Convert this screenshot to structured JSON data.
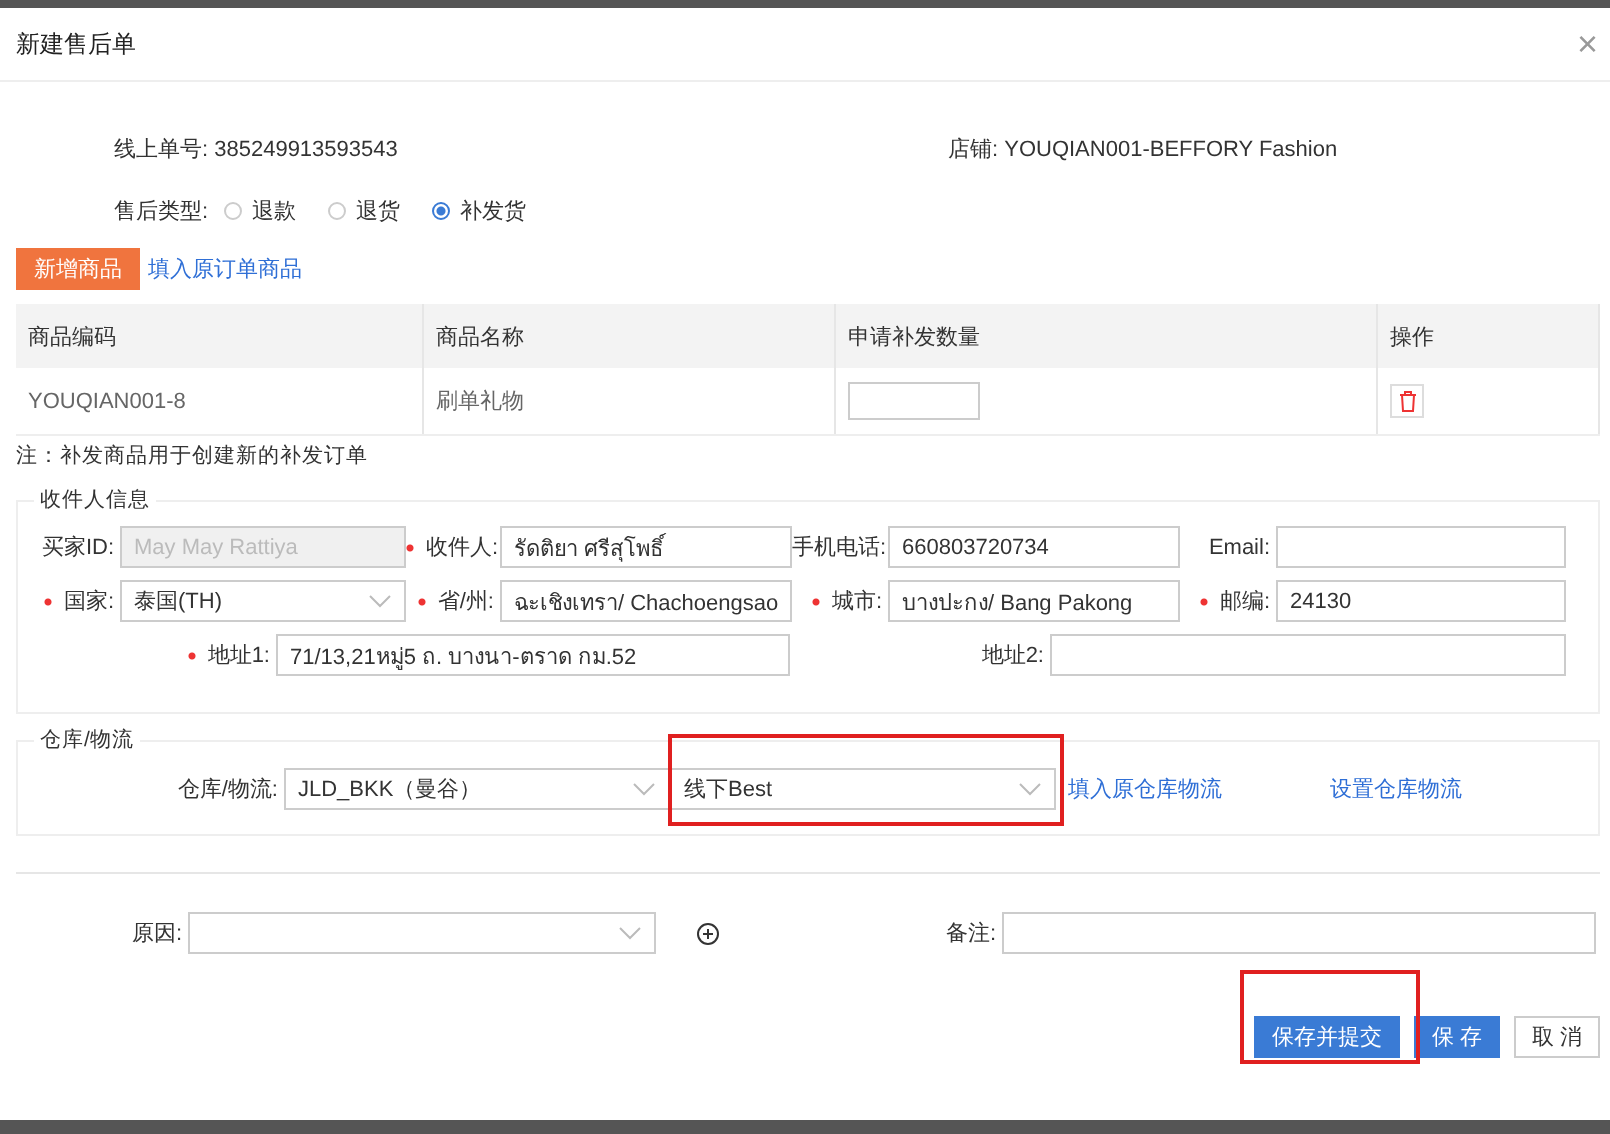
{
  "dialog": {
    "title": "新建售后单",
    "close": "×"
  },
  "order_info": [
    {
      "label": "线上单号:",
      "value": "385249913593543"
    },
    {
      "label": "店铺:",
      "value": "YOUQIAN001-BEFFORY Fashion"
    }
  ],
  "type": {
    "label": "售后类型:",
    "options": [
      {
        "label": "退款",
        "selected": false
      },
      {
        "label": "退货",
        "selected": false
      },
      {
        "label": "补发货",
        "selected": true
      }
    ]
  },
  "actions": {
    "add": "新增商品",
    "fill": "填入原订单商品"
  },
  "table": {
    "columns": [
      "商品编码",
      "商品名称",
      "申请补发数量",
      "操作"
    ],
    "rows": [
      {
        "code": "YOUQIAN001-8",
        "name": "刷单礼物"
      }
    ]
  },
  "note": "注：补发商品用于创建新的补发订单",
  "recipient": {
    "legend": "收件人信息",
    "rows": [
      [
        {
          "label": "买家ID:",
          "value": "May May Rattiya",
          "required": false,
          "kind": "input",
          "disabled": true
        },
        {
          "label": "收件人:",
          "value": "รัดติยา  ศรีสุโพธิ์",
          "required": true,
          "kind": "input",
          "disabled": false
        },
        {
          "label": "手机电话:",
          "value": "660803720734",
          "required": false,
          "kind": "input",
          "disabled": false
        },
        {
          "label": "Email:",
          "required": false,
          "kind": "input",
          "disabled": false
        }
      ],
      [
        {
          "label": "国家:",
          "value": "泰国(TH)",
          "required": true,
          "kind": "select",
          "disabled": false
        },
        {
          "label": "省/州:",
          "value": "ฉะเชิงเทรา/ Chachoengsao",
          "required": true,
          "kind": "input",
          "disabled": false
        },
        {
          "label": "城市:",
          "value": "บางปะกง/ Bang Pakong",
          "required": true,
          "kind": "input",
          "disabled": false
        },
        {
          "label": "邮编:",
          "value": "24130",
          "required": true,
          "kind": "input",
          "disabled": false
        }
      ]
    ],
    "address": [
      {
        "label": "地址1:",
        "value": "71/13,21หมู่5 ถ. บางนา-ตราด กม.52",
        "required": true
      },
      {
        "label": "地址2:",
        "required": false
      }
    ]
  },
  "warehouse": {
    "legend": "仓库/物流",
    "label": "仓库/物流:",
    "warehouse": "JLD_BKK（曼谷）",
    "carrier": "线下Best",
    "links": [
      "填入原仓库物流",
      "设置仓库物流"
    ]
  },
  "reason": {
    "label": "原因:"
  },
  "remark": {
    "label": "备注:"
  },
  "buttons": [
    {
      "label": "保存并提交",
      "kind": "primary"
    },
    {
      "label": "保 存",
      "kind": "primary"
    },
    {
      "label": "取 消",
      "kind": "default"
    }
  ]
}
